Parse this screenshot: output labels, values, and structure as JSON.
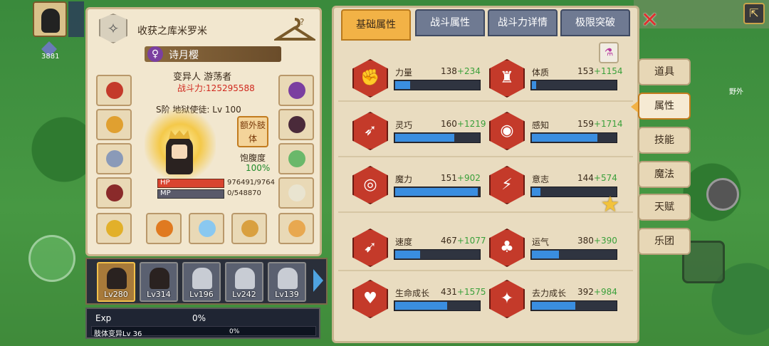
{
  "hud": {
    "gem_count": "3881",
    "world_label": "野外"
  },
  "character": {
    "guild_name": "收获之库米罗米",
    "name": "诗月樱",
    "class": "变异人 游荡者",
    "power": "战斗力:125295588",
    "rank": "S阶 地狱使徒: Lv 100",
    "extra_body_button": "额外肢体",
    "satiety_label": "饱腹度",
    "satiety_value": "100%",
    "hp_label": "HP",
    "hp_value": "976491/9764",
    "mp_label": "MP",
    "mp_value": "0/548870"
  },
  "team": [
    {
      "level": "Lv280",
      "selected": true
    },
    {
      "level": "Lv314",
      "selected": false
    },
    {
      "level": "Lv196",
      "selected": false
    },
    {
      "level": "Lv242",
      "selected": false
    },
    {
      "level": "Lv139",
      "selected": false
    }
  ],
  "exp": {
    "label": "Exp",
    "percent": "0%",
    "mutation_label": "肢体变异Lv 36",
    "mutation_percent": "0%"
  },
  "tabs": [
    {
      "label": "基础属性",
      "active": true
    },
    {
      "label": "战斗属性",
      "active": false
    },
    {
      "label": "战斗力详情",
      "active": false
    },
    {
      "label": "极限突破",
      "active": false
    }
  ],
  "attributes": [
    {
      "name": "力量",
      "base": "138",
      "bonus": "+234",
      "icon": "strength-icon",
      "glyph": "✊",
      "fill": 0.18
    },
    {
      "name": "体质",
      "base": "153",
      "bonus": "+1154",
      "icon": "constitution-icon",
      "glyph": "♜",
      "fill": 0.05
    },
    {
      "name": "灵巧",
      "base": "160",
      "bonus": "+1219",
      "icon": "dexterity-icon",
      "glyph": "➶",
      "fill": 0.7
    },
    {
      "name": "感知",
      "base": "159",
      "bonus": "+1714",
      "icon": "perception-icon",
      "glyph": "◉",
      "fill": 0.78
    },
    {
      "name": "魔力",
      "base": "151",
      "bonus": "+902",
      "icon": "magic-icon",
      "glyph": "◎",
      "fill": 0.98
    },
    {
      "name": "意志",
      "base": "144",
      "bonus": "+574",
      "icon": "will-icon",
      "glyph": "⚡",
      "fill": 0.1
    },
    {
      "name": "速度",
      "base": "467",
      "bonus": "+1077",
      "icon": "speed-icon",
      "glyph": "➹",
      "fill": 0.3
    },
    {
      "name": "运气",
      "base": "380",
      "bonus": "+390",
      "icon": "luck-icon",
      "glyph": "♣",
      "fill": 0.32
    },
    {
      "name": "生命成长",
      "base": "431",
      "bonus": "+1575",
      "icon": "life-growth-icon",
      "glyph": "♥",
      "fill": 0.62
    },
    {
      "name": "去力成长",
      "base": "392",
      "bonus": "+984",
      "icon": "force-growth-icon",
      "glyph": "✦",
      "fill": 0.52
    }
  ],
  "side_menu": [
    {
      "label": "道具",
      "active": false
    },
    {
      "label": "属性",
      "active": true
    },
    {
      "label": "技能",
      "active": false
    },
    {
      "label": "魔法",
      "active": false
    },
    {
      "label": "天赋",
      "active": false
    },
    {
      "label": "乐团",
      "active": false
    }
  ],
  "colors": {
    "accent": "#f2b246",
    "power_red": "#d0281e",
    "bonus_green": "#3aa03a",
    "bar_blue": "#3a8ee0"
  }
}
